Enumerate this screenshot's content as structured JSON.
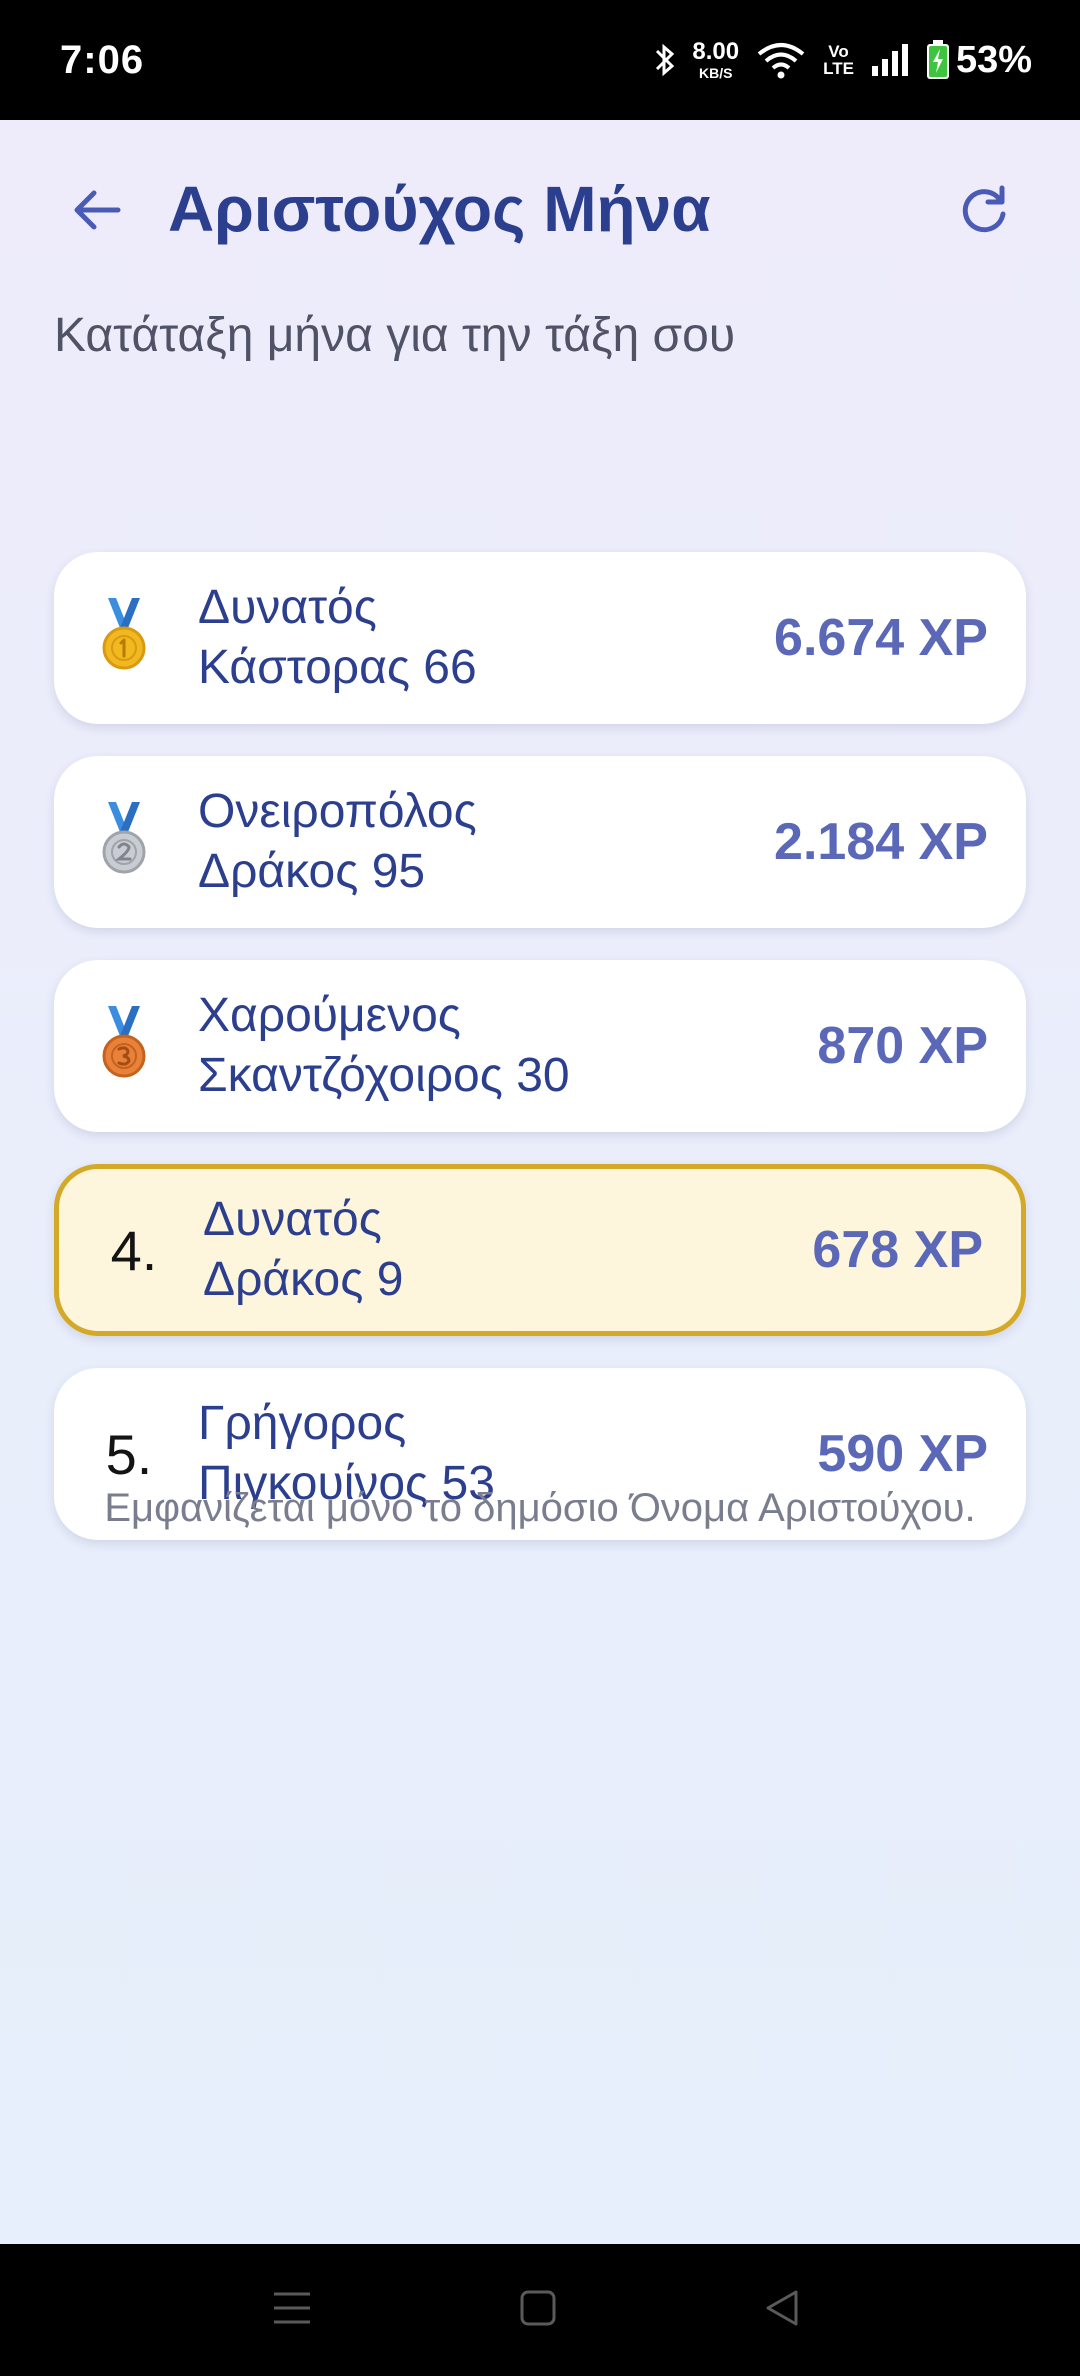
{
  "status_bar": {
    "time": "7:06",
    "net_speed_value": "8.00",
    "net_speed_unit": "KB/S",
    "volte_top": "Vo",
    "volte_bottom": "LTE",
    "battery_percent": "53%"
  },
  "header": {
    "title": "Αριστούχος Μήνα",
    "back_icon": "arrow-left-icon",
    "refresh_icon": "refresh-icon"
  },
  "subtitle": "Κατάταξη μήνα για την τάξη σου",
  "leaderboard": [
    {
      "rank": "1",
      "medal": "gold-medal-icon",
      "name_line1": "Δυνατός",
      "name_line2": "Κάστορας 66",
      "xp": "6.674 XP",
      "highlight": false
    },
    {
      "rank": "2",
      "medal": "silver-medal-icon",
      "name_line1": "Ονειροπόλος",
      "name_line2": "Δράκος 95",
      "xp": "2.184 XP",
      "highlight": false
    },
    {
      "rank": "3",
      "medal": "bronze-medal-icon",
      "name_line1": "Χαρούμενος",
      "name_line2": "Σκαντζόχοιρος 30",
      "xp": "870 XP",
      "highlight": false
    },
    {
      "rank": "4.",
      "medal": "",
      "name_line1": "Δυνατός",
      "name_line2": "Δράκος 9",
      "xp": "678 XP",
      "highlight": true
    },
    {
      "rank": "5.",
      "medal": "",
      "name_line1": "Γρήγορος",
      "name_line2": "Πιγκουίνος 53",
      "xp": "590 XP",
      "highlight": false
    }
  ],
  "footnote": "Εμφανίζεται μόνο το δημόσιο Όνομα Αριστούχου.",
  "colors": {
    "title": "#2c3f8f",
    "xp": "#5b68b8",
    "highlight_bg": "#fdf6dc",
    "highlight_border": "#d4a927",
    "gold": "#f2b822",
    "silver": "#b9bcc2",
    "bronze": "#e9813a",
    "ribbon": "#3b8de0"
  }
}
